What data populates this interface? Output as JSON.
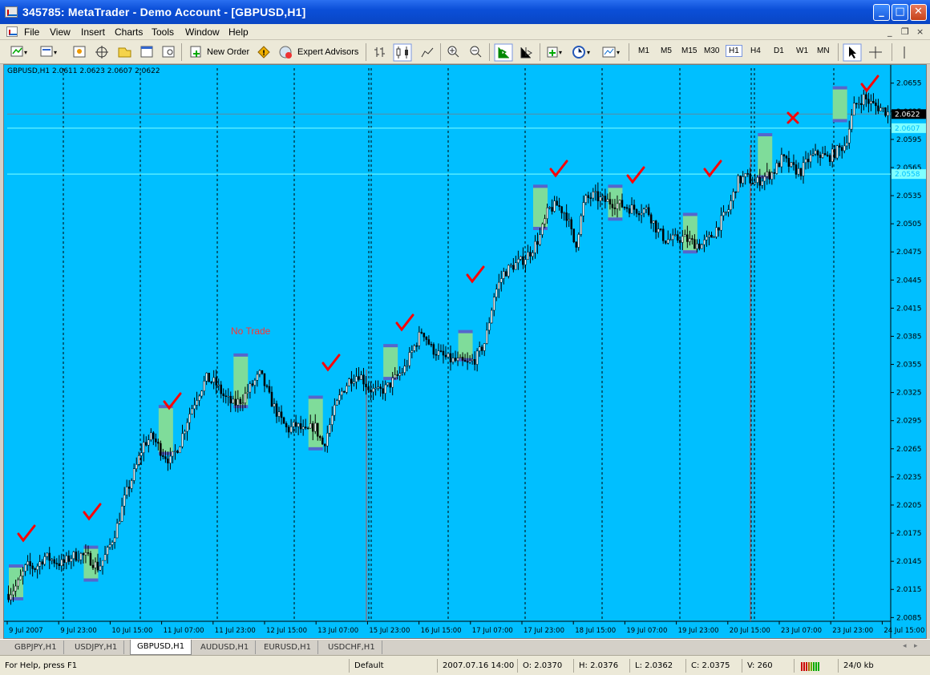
{
  "window": {
    "title": "345785: MetaTrader - Demo Account - [GBPUSD,H1]",
    "minimize": "_",
    "maximize": "□",
    "close": "✕"
  },
  "menu": {
    "items": [
      "File",
      "View",
      "Insert",
      "Charts",
      "Tools",
      "Window",
      "Help"
    ],
    "mdi_minimize": "_",
    "mdi_restore": "❐",
    "mdi_close": "×"
  },
  "toolbar": {
    "new_order": "New Order",
    "expert_advisors": "Expert Advisors",
    "timeframes": [
      "M1",
      "M5",
      "M15",
      "M30",
      "H1",
      "H4",
      "D1",
      "W1",
      "MN"
    ],
    "active_timeframe": "H1",
    "icons": [
      "new-chart-icon",
      "profiles-icon",
      "market-watch-icon",
      "crosshair-navigator-icon",
      "data-window-icon",
      "terminal-icon",
      "strategy-tester-icon",
      "new-order-icon",
      "expert-advisors-icon",
      "bar-chart-icon",
      "candlestick-icon",
      "line-chart-icon",
      "zoom-in-icon",
      "zoom-out-icon",
      "autoscroll-icon",
      "chart-shift-icon",
      "indicators-icon",
      "periods-icon",
      "templates-icon",
      "cursor-icon",
      "crosshair-icon",
      "vertical-line-icon"
    ]
  },
  "chart": {
    "info": "GBPUSD,H1  2.0611 2.0623 2.0607 2.0622",
    "current_price_label": "2.0622",
    "hline1_label": "2.0607",
    "hline2_label": "2.0558",
    "no_trade_label": "No Trade",
    "annotation_check_color": "#ff0000",
    "annotation_cross_color": "#ff0000",
    "background": "#00bfff",
    "box_fill": "#7fdc9a",
    "box_border": "#5566cc"
  },
  "chart_data": {
    "type": "candlestick",
    "symbol": "GBPUSD",
    "timeframe": "H1",
    "y_ticks": [
      "2.0655",
      "2.0625",
      "2.0595",
      "2.0565",
      "2.0535",
      "2.0505",
      "2.0475",
      "2.0445",
      "2.0415",
      "2.0385",
      "2.0355",
      "2.0325",
      "2.0295",
      "2.0265",
      "2.0235",
      "2.0205",
      "2.0175",
      "2.0145",
      "2.0115",
      "2.0085"
    ],
    "ylim": [
      2.0081,
      2.0671
    ],
    "x_ticks": [
      "9 Jul 2007",
      "9 Jul 23:00",
      "10 Jul 15:00",
      "11 Jul 07:00",
      "11 Jul 23:00",
      "12 Jul 15:00",
      "13 Jul 07:00",
      "15 Jul 23:00",
      "16 Jul 15:00",
      "17 Jul 07:00",
      "17 Jul 23:00",
      "18 Jul 15:00",
      "19 Jul 07:00",
      "19 Jul 23:00",
      "20 Jul 15:00",
      "23 Jul 07:00",
      "23 Jul 23:00",
      "24 Jul 15:00"
    ],
    "horizontal_lines": [
      2.0622,
      2.0607,
      2.0558
    ],
    "close_path": [
      [
        0,
        2.011
      ],
      [
        3,
        2.012
      ],
      [
        6,
        2.014
      ],
      [
        9,
        2.0138
      ],
      [
        12,
        2.015
      ],
      [
        15,
        2.0146
      ],
      [
        18,
        2.0142
      ],
      [
        21,
        2.015
      ],
      [
        24,
        2.0152
      ],
      [
        27,
        2.0148
      ],
      [
        30,
        2.0138
      ],
      [
        33,
        2.0155
      ],
      [
        36,
        2.018
      ],
      [
        39,
        2.0215
      ],
      [
        42,
        2.024
      ],
      [
        45,
        2.027
      ],
      [
        48,
        2.0278
      ],
      [
        51,
        2.0262
      ],
      [
        54,
        2.0252
      ],
      [
        57,
        2.027
      ],
      [
        60,
        2.03
      ],
      [
        63,
        2.0322
      ],
      [
        66,
        2.034
      ],
      [
        69,
        2.0335
      ],
      [
        72,
        2.032
      ],
      [
        75,
        2.0312
      ],
      [
        78,
        2.0318
      ],
      [
        81,
        2.0332
      ],
      [
        84,
        2.0345
      ],
      [
        87,
        2.032
      ],
      [
        90,
        2.03
      ],
      [
        93,
        2.0285
      ],
      [
        96,
        2.029
      ],
      [
        99,
        2.0282
      ],
      [
        102,
        2.029
      ],
      [
        105,
        2.0268
      ],
      [
        108,
        2.03
      ],
      [
        111,
        2.0325
      ],
      [
        114,
        2.034
      ],
      [
        117,
        2.0345
      ],
      [
        120,
        2.033
      ],
      [
        123,
        2.0325
      ],
      [
        126,
        2.033
      ],
      [
        129,
        2.034
      ],
      [
        132,
        2.035
      ],
      [
        135,
        2.0372
      ],
      [
        138,
        2.0392
      ],
      [
        141,
        2.0372
      ],
      [
        144,
        2.0365
      ],
      [
        147,
        2.036
      ],
      [
        150,
        2.0358
      ],
      [
        153,
        2.0355
      ],
      [
        156,
        2.0362
      ],
      [
        159,
        2.038
      ],
      [
        162,
        2.043
      ],
      [
        165,
        2.0452
      ],
      [
        168,
        2.046
      ],
      [
        171,
        2.0465
      ],
      [
        174,
        2.0475
      ],
      [
        177,
        2.049
      ],
      [
        180,
        2.052
      ],
      [
        183,
        2.0525
      ],
      [
        186,
        2.0515
      ],
      [
        189,
        2.048
      ],
      [
        192,
        2.053
      ],
      [
        195,
        2.0535
      ],
      [
        198,
        2.053
      ],
      [
        201,
        2.0528
      ],
      [
        204,
        2.0525
      ],
      [
        207,
        2.0522
      ],
      [
        210,
        2.052
      ],
      [
        213,
        2.052
      ],
      [
        216,
        2.05
      ],
      [
        219,
        2.0488
      ],
      [
        222,
        2.0488
      ],
      [
        225,
        2.049
      ],
      [
        228,
        2.0485
      ],
      [
        231,
        2.0482
      ],
      [
        234,
        2.049
      ],
      [
        237,
        2.0505
      ],
      [
        240,
        2.052
      ],
      [
        243,
        2.055
      ],
      [
        246,
        2.0555
      ],
      [
        249,
        2.0548
      ],
      [
        252,
        2.0555
      ],
      [
        255,
        2.056
      ],
      [
        258,
        2.0575
      ],
      [
        261,
        2.0565
      ],
      [
        264,
        2.056
      ],
      [
        267,
        2.0575
      ],
      [
        270,
        2.058
      ],
      [
        273,
        2.0575
      ],
      [
        276,
        2.0582
      ],
      [
        279,
        2.059
      ],
      [
        282,
        2.063
      ],
      [
        285,
        2.064
      ],
      [
        288,
        2.0632
      ],
      [
        291,
        2.0628
      ],
      [
        294,
        2.0622
      ]
    ],
    "boxes": [
      {
        "i": 1,
        "low": 2.0105,
        "high": 2.014,
        "mark": "check"
      },
      {
        "i": 32,
        "low": 2.0125,
        "high": 2.016,
        "mark": "check"
      },
      {
        "i": 63,
        "low": 2.026,
        "high": 2.031,
        "mark": "check"
      },
      {
        "i": 94,
        "low": 2.031,
        "high": 2.0365,
        "mark": "no-trade"
      },
      {
        "i": 125,
        "low": 2.0265,
        "high": 2.032,
        "mark": "check"
      },
      {
        "i": 156,
        "low": 2.034,
        "high": 2.0375,
        "mark": "check"
      },
      {
        "i": 187,
        "low": 2.036,
        "high": 2.039,
        "mark": "check"
      },
      {
        "i": 218,
        "low": 2.05,
        "high": 2.0545,
        "mark": "check"
      },
      {
        "i": 249,
        "low": 2.051,
        "high": 2.0545,
        "mark": "check"
      },
      {
        "i": 280,
        "low": 2.0475,
        "high": 2.0515,
        "mark": "check"
      },
      {
        "i": 311,
        "low": 2.0555,
        "high": 2.06,
        "mark": "cross"
      },
      {
        "i": 342,
        "low": 2.0615,
        "high": 2.065,
        "mark": "check"
      }
    ]
  },
  "tabs": [
    "GBPJPY,H1",
    "USDJPY,H1",
    "GBPUSD,H1",
    "AUDUSD,H1",
    "EURUSD,H1",
    "USDCHF,H1"
  ],
  "active_tab": "GBPUSD,H1",
  "status": {
    "help": "For Help, press F1",
    "profile": "Default",
    "datetime": "2007.07.16 14:00",
    "open": "O: 2.0370",
    "high": "H: 2.0376",
    "low": "L: 2.0362",
    "close": "C: 2.0375",
    "volume": "V: 260",
    "traffic": "24/0 kb"
  }
}
